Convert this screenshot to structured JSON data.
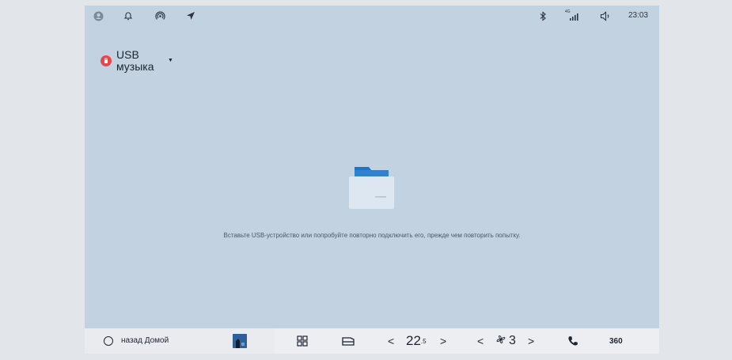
{
  "status_bar": {
    "time": "23:03",
    "signal_tag": "4G",
    "left_icons": [
      "avatar-icon",
      "bell-icon",
      "hotspot-icon",
      "navigation-arrow-icon"
    ],
    "right_icons": [
      "bluetooth-icon",
      "cellular-signal-icon",
      "volume-icon"
    ]
  },
  "source": {
    "label": "USB музыка",
    "icon": "usb-icon",
    "badge_color": "#e7474b"
  },
  "empty_state": {
    "icon": "folder-icon",
    "message": "Вставьте USB-устройство или попробуйте повторно подключить его, прежде чем повторить попытку."
  },
  "dock": {
    "home_label": "назад Домой",
    "apps_icon": "grid-icon",
    "seat_icon": "seat-icon",
    "temperature": {
      "whole": "22",
      "fraction": ".5"
    },
    "fan": {
      "mode": "AUTO",
      "level": "3"
    },
    "phone_icon": "phone-icon",
    "camera_label": "360"
  },
  "colors": {
    "screen_bg": "#c2d2e1",
    "dock_bg": "#eceef1",
    "folder_blue": "#2474c4"
  }
}
